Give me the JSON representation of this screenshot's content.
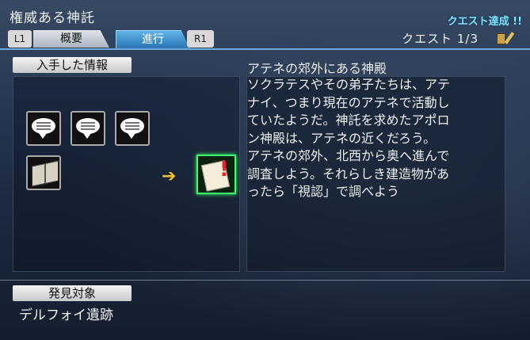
{
  "header": {
    "title": "権威ある神託",
    "achieved_label": "クエスト達成 !!",
    "quest_count": "クエスト 1/3"
  },
  "tabs": {
    "left_button": "L1",
    "overview": "概要",
    "progress": "進行",
    "right_button": "R1"
  },
  "info": {
    "label": "入手した情報",
    "items": [
      "speech-bubble-icon",
      "speech-bubble-icon",
      "speech-bubble-icon",
      "book-icon"
    ],
    "result_icon": "oracle-note-icon"
  },
  "description": {
    "title": "アテネの郊外にある神殿",
    "body": "ソクラテスやその弟子たちは、アテ\nナイ、つまり現在のアテネで活動し\nていたようだ。神託を求めたアポロ\nン神殿は、アテネの近くだろう。\nアテネの郊外、北西から奥へ進んで\n調査しよう。それらしき建造物があ\nったら「視認」で調べよう"
  },
  "discovery": {
    "label": "発見対象",
    "value": "デルフォイ遺跡"
  },
  "colors": {
    "accent": "#7fe0ff",
    "active_tab": "#2b74b4",
    "highlight": "#39ff6a",
    "arrow": "#f0c02a"
  }
}
